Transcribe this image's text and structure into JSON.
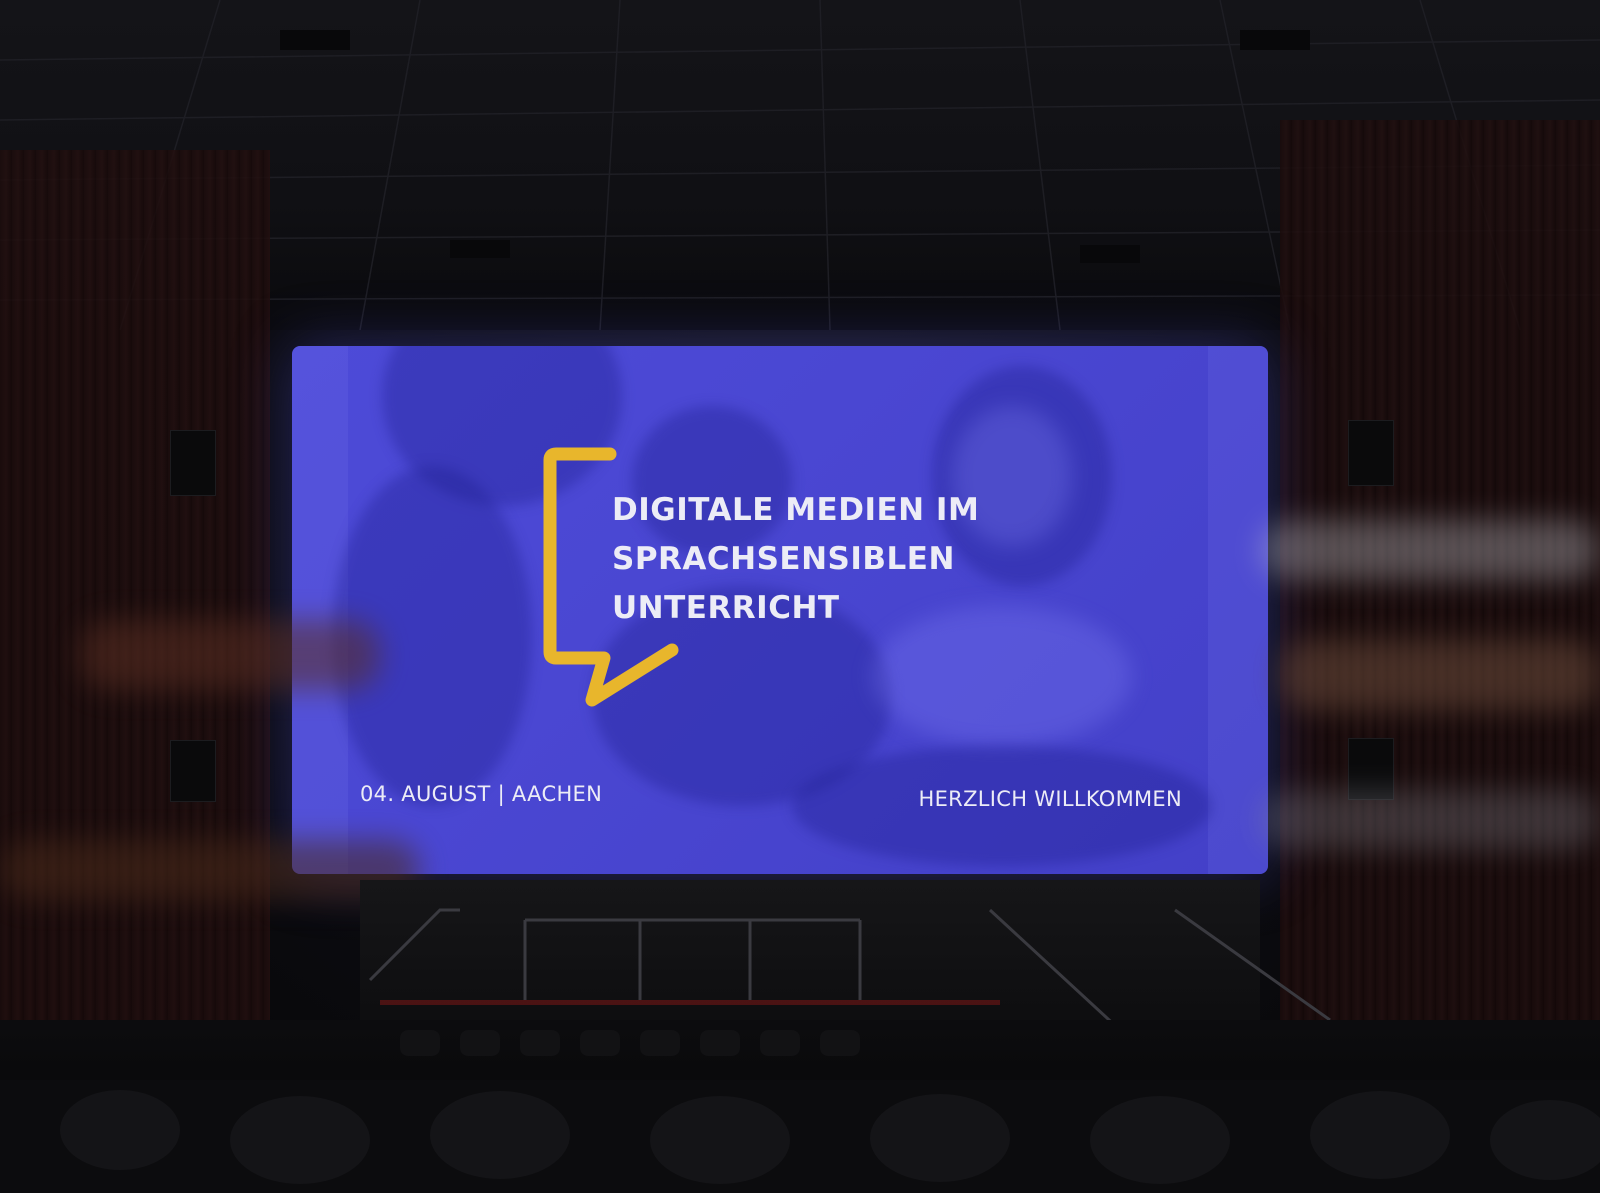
{
  "screen": {
    "title_lines": [
      "DIGITALE MEDIEN IM",
      "SPRACHSENSIBLEN",
      "UNTERRICHT"
    ],
    "date_location": "04. AUGUST | AACHEN",
    "welcome": "HERZLICH WILLKOMMEN"
  },
  "colors": {
    "screen_blue": "#4a47d2",
    "accent_yellow": "#e8b62c",
    "text_light": "#ececf6"
  },
  "icons": {
    "logo": "speech-bracket-icon"
  }
}
